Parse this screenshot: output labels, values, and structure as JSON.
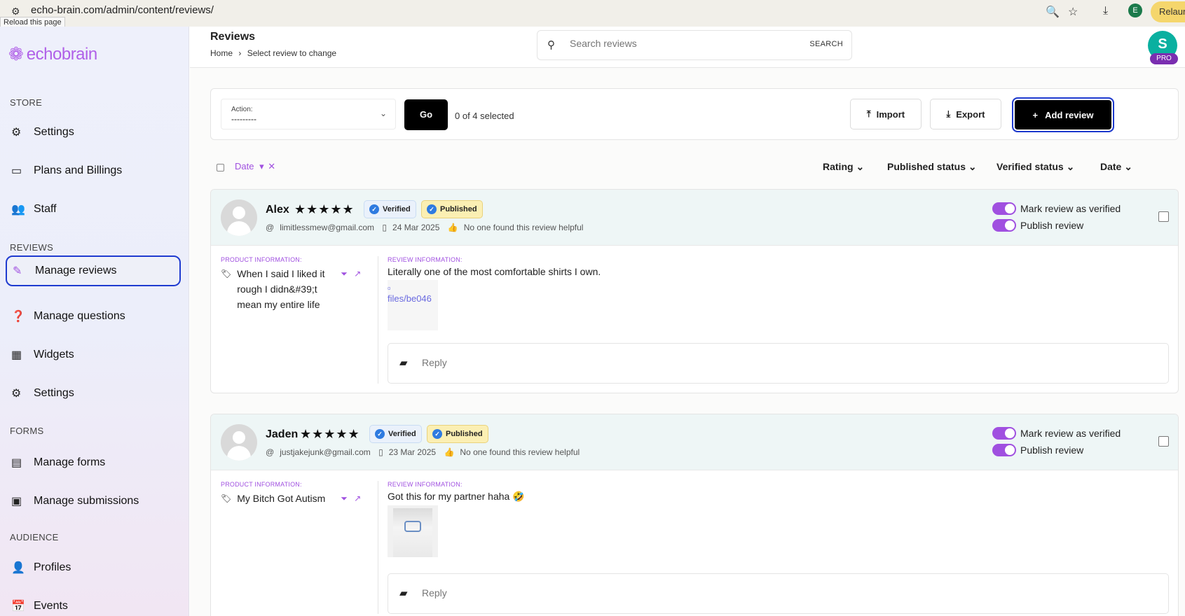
{
  "browser": {
    "url": "echo-brain.com/admin/content/reviews/",
    "tooltip": "Reload this page",
    "profile_initial": "E",
    "relaunch_label": "Relaun"
  },
  "sidebar": {
    "logo_text": "echobrain",
    "sections": {
      "store": "STORE",
      "reviews": "REVIEWS",
      "forms": "FORMS",
      "audience": "AUDIENCE"
    },
    "items": [
      {
        "label": "Settings",
        "icon": "gear-icon"
      },
      {
        "label": "Plans and Billings",
        "icon": "card-icon"
      },
      {
        "label": "Staff",
        "icon": "people-icon"
      },
      {
        "label": "Manage reviews",
        "icon": "review-edit-icon",
        "active": true
      },
      {
        "label": "Manage questions",
        "icon": "question-icon"
      },
      {
        "label": "Widgets",
        "icon": "widgets-icon"
      },
      {
        "label": "Settings",
        "icon": "gear-icon"
      },
      {
        "label": "Manage forms",
        "icon": "form-icon"
      },
      {
        "label": "Manage submissions",
        "icon": "submissions-icon"
      },
      {
        "label": "Profiles",
        "icon": "person-icon"
      },
      {
        "label": "Events",
        "icon": "calendar-icon"
      }
    ]
  },
  "header": {
    "title": "Reviews",
    "breadcrumb_home": "Home",
    "breadcrumb_sep": "›",
    "breadcrumb_current": "Select review to change",
    "search_placeholder": "Search reviews",
    "search_button": "SEARCH",
    "user_initial": "S",
    "plan_badge": "PRO"
  },
  "actions": {
    "action_label": "Action:",
    "action_value": "---------",
    "go_label": "Go",
    "selected_text": "0 of 4 selected",
    "import_label": "Import",
    "export_label": "Export",
    "add_label": "Add review"
  },
  "filters": {
    "active_filter": "Date",
    "sort_options": [
      "Rating",
      "Published status",
      "Verified status",
      "Date"
    ]
  },
  "labels": {
    "product_info": "PRODUCT INFORMATION:",
    "review_info": "REVIEW INFORMATION:",
    "verified": "Verified",
    "published": "Published",
    "mark_verified": "Mark review as verified",
    "publish_review": "Publish review",
    "reply_placeholder": "Reply",
    "helpful": "No one found this review helpful"
  },
  "reviews": [
    {
      "name": "Alex",
      "stars": "★★★★★",
      "email": "limitlessmew@gmail.com",
      "date": "24 Mar 2025",
      "product": "When I said I liked it rough I didn&#39;t mean my entire life",
      "text": "Literally one of the most comfortable shirts I own.",
      "image_alt": "files/be046",
      "verified_on": true,
      "published_on": true
    },
    {
      "name": "Jaden",
      "stars": "★★★★★",
      "email": "justjakejunk@gmail.com",
      "date": "23 Mar 2025",
      "product": "My Bitch Got Autism",
      "text": "Got this for my partner haha 🤣",
      "verified_on": true,
      "published_on": true
    }
  ]
}
